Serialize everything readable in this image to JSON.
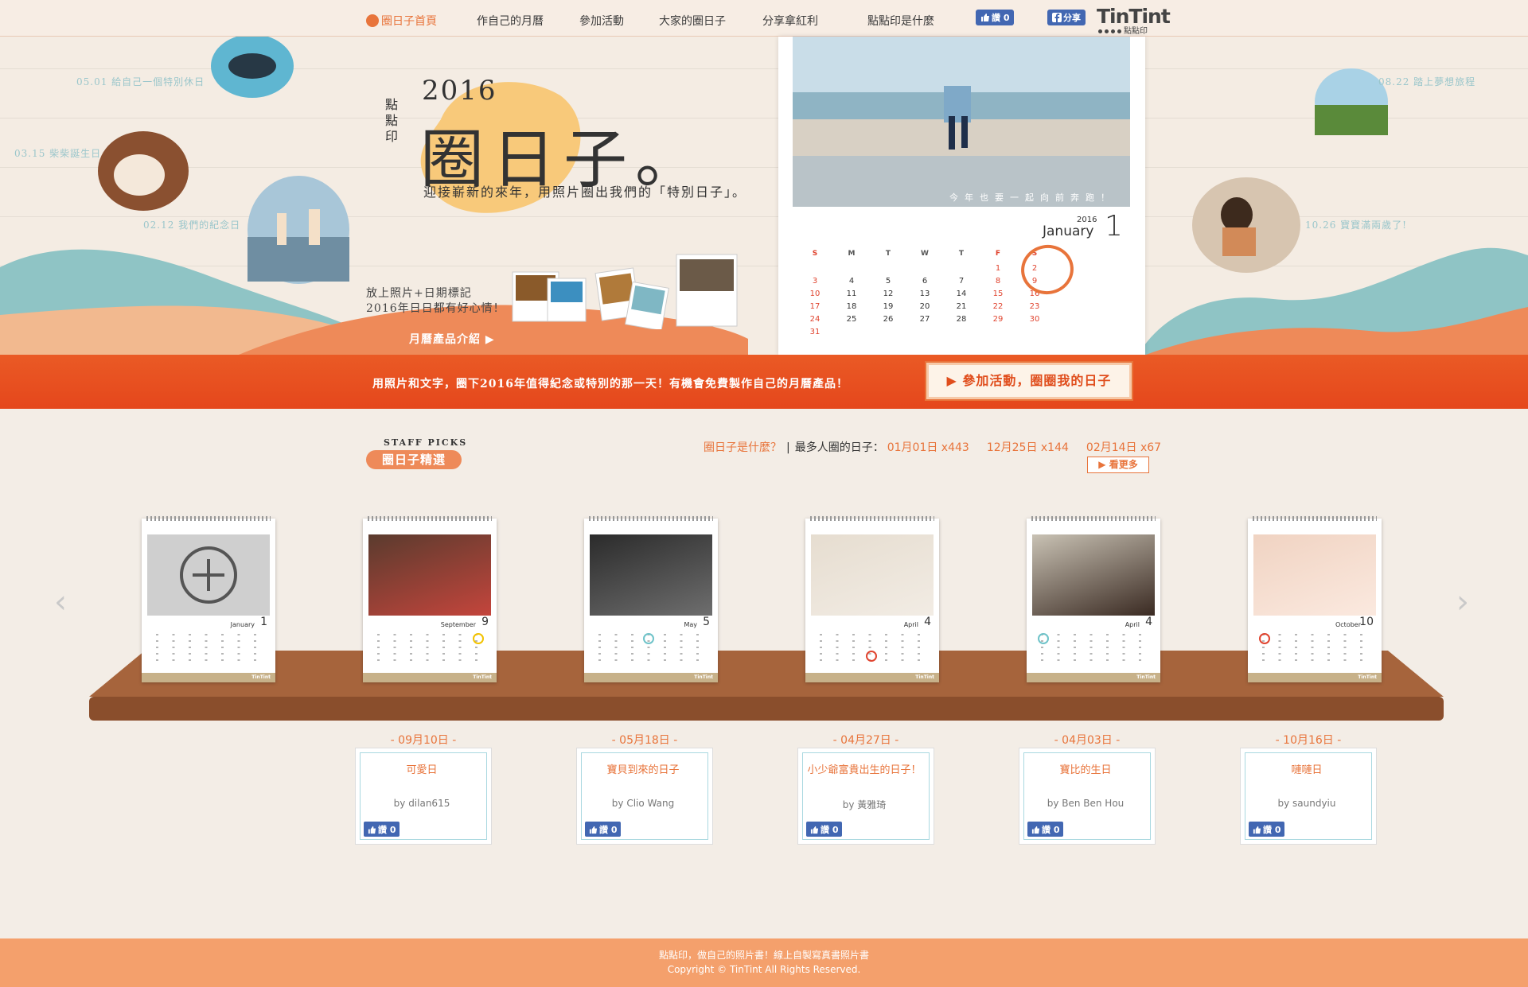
{
  "nav": {
    "items": [
      "圈日子首頁",
      "作自己的月曆",
      "參加活動",
      "大家的圈日子",
      "分享拿紅利",
      "點點印是什麼"
    ],
    "like_label": "讚 0",
    "share_label": "分享",
    "logo": "TinTint",
    "logo_sub": "點點印"
  },
  "hero": {
    "memories": [
      "05.01 給自己一個特別休日",
      "03.15 柴柴誕生日",
      "02.12 我們的紀念日",
      "08.22 踏上夢想旅程",
      "10.26 寶寶滿兩歲了!"
    ],
    "brand_vertical": "點點印",
    "year": "2016",
    "title": "圈日子。",
    "subtitle": "迎接嶄新的來年，用照片圈出我們的「特別日子」。",
    "tagline_1": "放上照片+日期標記",
    "tagline_2": "2016年日日都有好心情！",
    "intro_link": "月曆產品介紹 ▶"
  },
  "calendar": {
    "quote": "今年也要一起向前奔跑！",
    "year": "2016",
    "month": "January",
    "day": "1",
    "weekdays": [
      "S",
      "M",
      "T",
      "W",
      "T",
      "F",
      "S"
    ],
    "rows": [
      [
        "",
        "",
        "",
        "",
        "",
        "1",
        "2"
      ],
      [
        "3",
        "4",
        "5",
        "6",
        "7",
        "8",
        "9"
      ],
      [
        "10",
        "11",
        "12",
        "13",
        "14",
        "15",
        "16"
      ],
      [
        "17",
        "18",
        "19",
        "20",
        "21",
        "22",
        "23"
      ],
      [
        "24",
        "25",
        "26",
        "27",
        "28",
        "29",
        "30"
      ],
      [
        "31",
        "",
        "",
        "",
        "",
        "",
        ""
      ]
    ]
  },
  "banner": {
    "text": "用照片和文字，圈下2016年值得紀念或特別的那一天！有機會免費製作自己的月曆產品！",
    "button": "▶ 參加活動，圈圈我的日子"
  },
  "staff": {
    "en": "STAFF PICKS",
    "label": "圈日子精選",
    "what": "圈日子是什麼？",
    "most_label": "最多人圈的日子：",
    "top_days": [
      "01月01日 x443",
      "12月25日 x144",
      "02月14日 x67"
    ],
    "more": "▶ 看更多"
  },
  "minis": [
    {
      "month": "January",
      "day": "1",
      "add": true
    },
    {
      "month": "September",
      "day": "9",
      "mark": "#f2c200"
    },
    {
      "month": "May",
      "day": "5",
      "mark": "#6fc3c9"
    },
    {
      "month": "April",
      "day": "4",
      "mark": "#e0442f"
    },
    {
      "month": "April",
      "day": "4",
      "mark": "#6fc3c9"
    },
    {
      "month": "October",
      "day": "10",
      "mark": "#e0442f"
    }
  ],
  "cards": [
    {
      "date": "- 09月10日 -",
      "title": "可愛日",
      "by": "by dilan615",
      "like": "讚 0"
    },
    {
      "date": "- 05月18日 -",
      "title": "寶貝到來的日子",
      "by": "by Clio Wang",
      "like": "讚 0"
    },
    {
      "date": "- 04月27日 -",
      "title": "小少爺富貴出生的日子！",
      "by": "by 黃雅琦",
      "like": "讚 0"
    },
    {
      "date": "- 04月03日 -",
      "title": "寶比的生日",
      "by": "by Ben Ben Hou",
      "like": "讚 0"
    },
    {
      "date": "- 10月16日 -",
      "title": "嗹嗹日",
      "by": "by saundyiu",
      "like": "讚 0"
    }
  ],
  "footer": {
    "line1": "點點印，做自己的照片書！線上自製寫真書照片書",
    "line2": "Copyright © TinTint All Rights Reserved."
  },
  "colors": {
    "accent": "#e8743b",
    "banner": "#e9511f",
    "footer": "#f4a06c",
    "teal": "#8fc4c5",
    "facebook": "#4267b2"
  }
}
